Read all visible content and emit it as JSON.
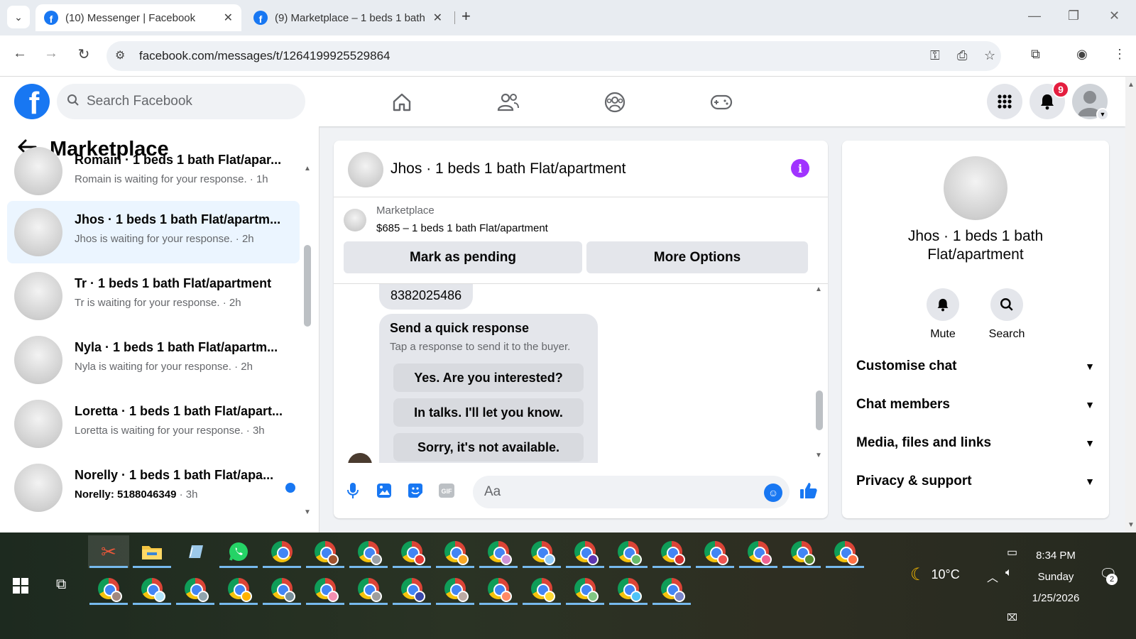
{
  "browser": {
    "tabs": [
      {
        "title": "(10) Messenger | Facebook",
        "active": true
      },
      {
        "title": "(9) Marketplace – 1 beds 1 bath",
        "active": false
      }
    ],
    "url": "facebook.com/messages/t/1264199925529864"
  },
  "header": {
    "search_placeholder": "Search Facebook",
    "notification_count": "9",
    "brand_color": "#1877f2"
  },
  "sidebar": {
    "title": "Marketplace",
    "conversations": [
      {
        "name": "Romain · 1 beds 1 bath Flat/apar...",
        "preview": "Romain is waiting for your response.",
        "time": "· 1h",
        "unread": false,
        "selected": false
      },
      {
        "name": "Jhos · 1 beds 1 bath Flat/apartm...",
        "preview": "Jhos is waiting for your response.",
        "time": "· 2h",
        "unread": false,
        "selected": true
      },
      {
        "name": "Tr · 1 beds 1 bath Flat/apartment",
        "preview": "Tr is waiting for your response.",
        "time": "· 2h",
        "unread": false,
        "selected": false
      },
      {
        "name": "Nyla · 1 beds 1 bath Flat/apartm...",
        "preview": "Nyla is waiting for your response.",
        "time": "· 2h",
        "unread": false,
        "selected": false
      },
      {
        "name": "Loretta · 1 beds 1 bath Flat/apart...",
        "preview": "Loretta is waiting for your response.",
        "time": "· 3h",
        "unread": false,
        "selected": false
      },
      {
        "name": "Norelly · 1 beds 1 bath Flat/apa...",
        "preview": "Norelly: 5188046349",
        "time": "· 3h",
        "unread": true,
        "selected": false
      }
    ]
  },
  "chat": {
    "title": "Jhos · 1 beds 1 bath Flat/apartment",
    "listing_label": "Marketplace",
    "listing_price": "$685 – 1 beds 1 bath Flat/apartment",
    "mark_pending": "Mark as pending",
    "more_options": "More Options",
    "phone_message": "8382025486",
    "quick_title": "Send a quick response",
    "quick_sub": "Tap a response to send it to the buyer.",
    "quick_responses": [
      "Yes. Are you interested?",
      "In talks. I'll let you know.",
      "Sorry, it's not available."
    ],
    "composer_placeholder": "Aa"
  },
  "info_panel": {
    "name": "Jhos · 1 beds 1 bath Flat/apartment",
    "actions": [
      {
        "label": "Mute",
        "icon": "bell-icon"
      },
      {
        "label": "Search",
        "icon": "search-icon"
      }
    ],
    "sections": [
      "Customise chat",
      "Chat members",
      "Media, files and links",
      "Privacy & support"
    ]
  },
  "taskbar": {
    "weather": "10°C",
    "time": "8:34 PM",
    "day": "Sunday",
    "date": "1/25/2026",
    "notification_count": "2"
  }
}
